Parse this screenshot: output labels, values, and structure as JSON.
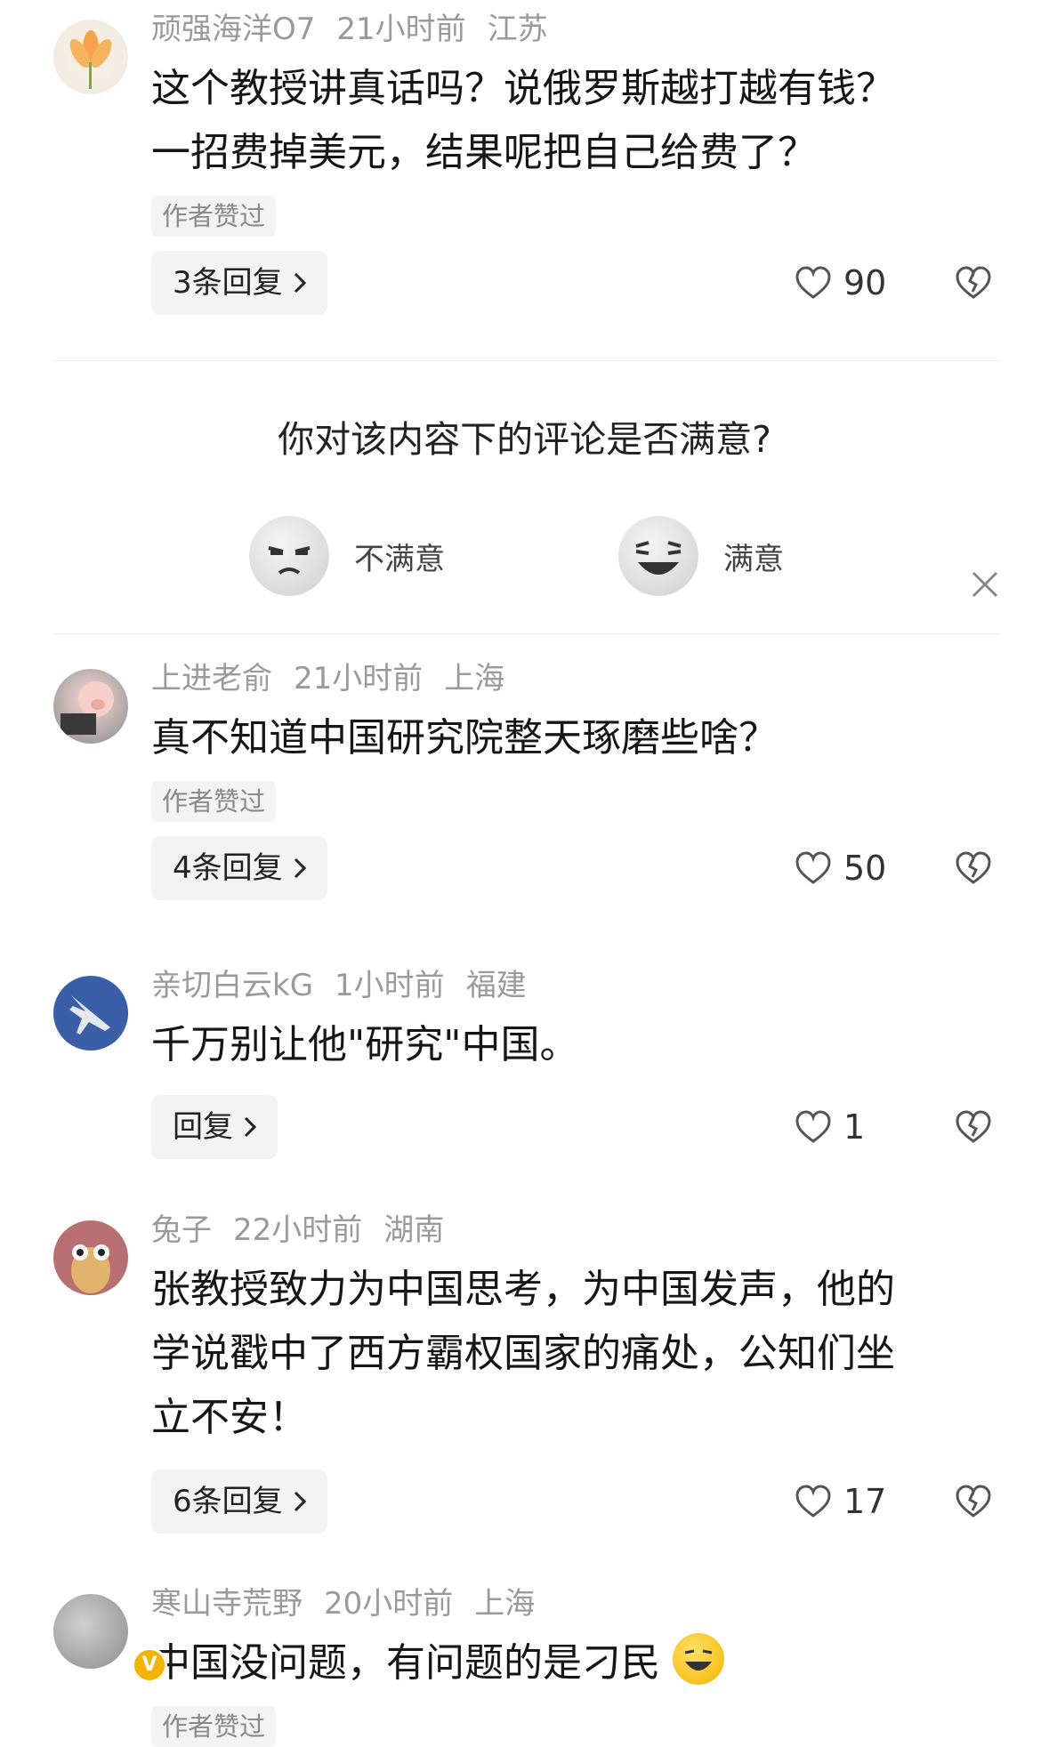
{
  "comments": [
    {
      "username": "顽强海洋O7",
      "time": "21小时前",
      "location": "江苏",
      "text_lines": [
        "这个教授讲真话吗？说俄罗斯越打越有钱？",
        "一招费掉美元，结果呢把自己给费了？"
      ],
      "author_liked": "作者赞过",
      "reply_label": "3条回复",
      "likes": "90"
    },
    {
      "username": "上进老俞",
      "time": "21小时前",
      "location": "上海",
      "text_lines": [
        "真不知道中国研究院整天琢磨些啥？"
      ],
      "author_liked": "作者赞过",
      "reply_label": "4条回复",
      "likes": "50"
    },
    {
      "username": "亲切白云kG",
      "time": "1小时前",
      "location": "福建",
      "text_lines": [
        "千万别让他\"研究\"中国。"
      ],
      "reply_label": "回复",
      "likes": "1"
    },
    {
      "username": "兔子",
      "time": "22小时前",
      "location": "湖南",
      "text_lines": [
        "张教授致力为中国思考，为中国发声，他的",
        "学说戳中了西方霸权国家的痛处，公知们坐",
        "立不安！"
      ],
      "reply_label": "6条回复",
      "likes": "17"
    },
    {
      "username": "寒山寺荒野",
      "time": "20小时前",
      "location": "上海",
      "text_lines": [
        "中国没问题，有问题的是刁民"
      ],
      "author_liked": "作者赞过"
    }
  ],
  "survey": {
    "question": "你对该内容下的评论是否满意?",
    "negative_label": "不满意",
    "positive_label": "满意"
  },
  "icons": {
    "like": "heart-outline-icon",
    "dislike": "broken-heart-icon",
    "close": "close-icon",
    "chevron": "chevron-right-icon",
    "verified": "verified-badge-icon"
  },
  "colors": {
    "meta_text": "#9a9a9a",
    "tag_bg": "#f3f3f3",
    "badge": "#f4b400"
  }
}
